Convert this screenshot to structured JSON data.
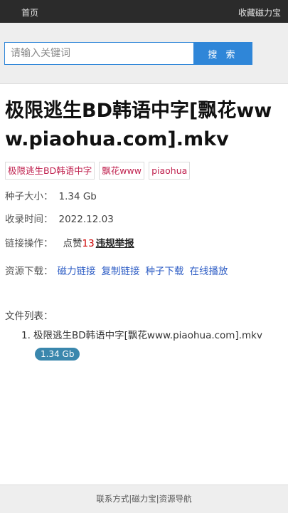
{
  "nav": {
    "home": "首页",
    "favorite": "收藏磁力宝"
  },
  "search": {
    "placeholder": "请输入关键词",
    "button": "搜 索"
  },
  "title": "极限逃生BD韩语中字[飘花www.piaohua.com].mkv",
  "tags": [
    "极限逃生BD韩语中字",
    "飘花www",
    "piaohua"
  ],
  "info": {
    "size_label": "种子大小：",
    "size_value": "1.34 Gb",
    "time_label": "收录时间：",
    "time_value": "2022.12.03",
    "ops_label": "链接操作：",
    "like_label": "点赞",
    "like_count": "13",
    "report_label": "违规举报",
    "download_label": "资源下载：",
    "download_links": [
      "磁力链接",
      "复制链接",
      "种子下载",
      "在线播放"
    ]
  },
  "files": {
    "label": "文件列表：",
    "items": [
      {
        "num": "1.",
        "name": "极限逃生BD韩语中字[飘花www.piaohua.com].mkv",
        "size": "1.34 Gb"
      }
    ]
  },
  "footer": {
    "links": [
      "联系方式",
      "磁力宝",
      "资源导航"
    ],
    "separator": "|"
  },
  "colors": {
    "accent": "#2f86d8",
    "tag_text": "#c0224f",
    "link": "#2b5bc4",
    "badge": "#3a87ad"
  }
}
